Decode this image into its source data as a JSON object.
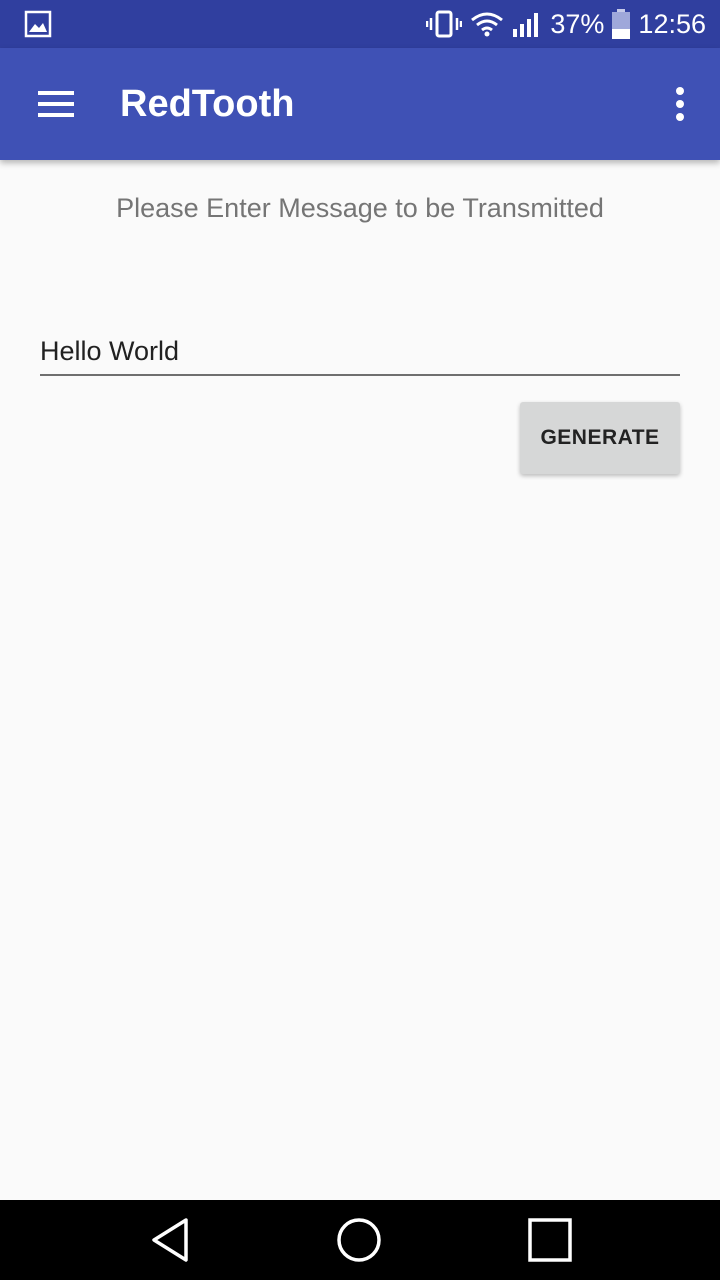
{
  "status_bar": {
    "battery_percent": "37%",
    "time": "12:56",
    "battery_level": 0.37,
    "icons": [
      "gallery-notification-icon",
      "vibrate-icon",
      "wifi-icon",
      "cell-signal-icon",
      "battery-icon"
    ]
  },
  "app_bar": {
    "title": "RedTooth",
    "menu_icon": "hamburger-menu-icon",
    "overflow_icon": "more-vert-icon"
  },
  "main": {
    "prompt": "Please Enter Message to be Transmitted",
    "message_value": "Hello World",
    "generate_label": "GENERATE"
  },
  "nav_bar": {
    "icons": [
      "back-icon",
      "home-icon",
      "recents-icon"
    ]
  },
  "colors": {
    "status_bar": "#303f9f",
    "app_bar": "#3f51b5",
    "background": "#fafafa",
    "button": "#d6d7d7",
    "hint_text": "#757575"
  }
}
